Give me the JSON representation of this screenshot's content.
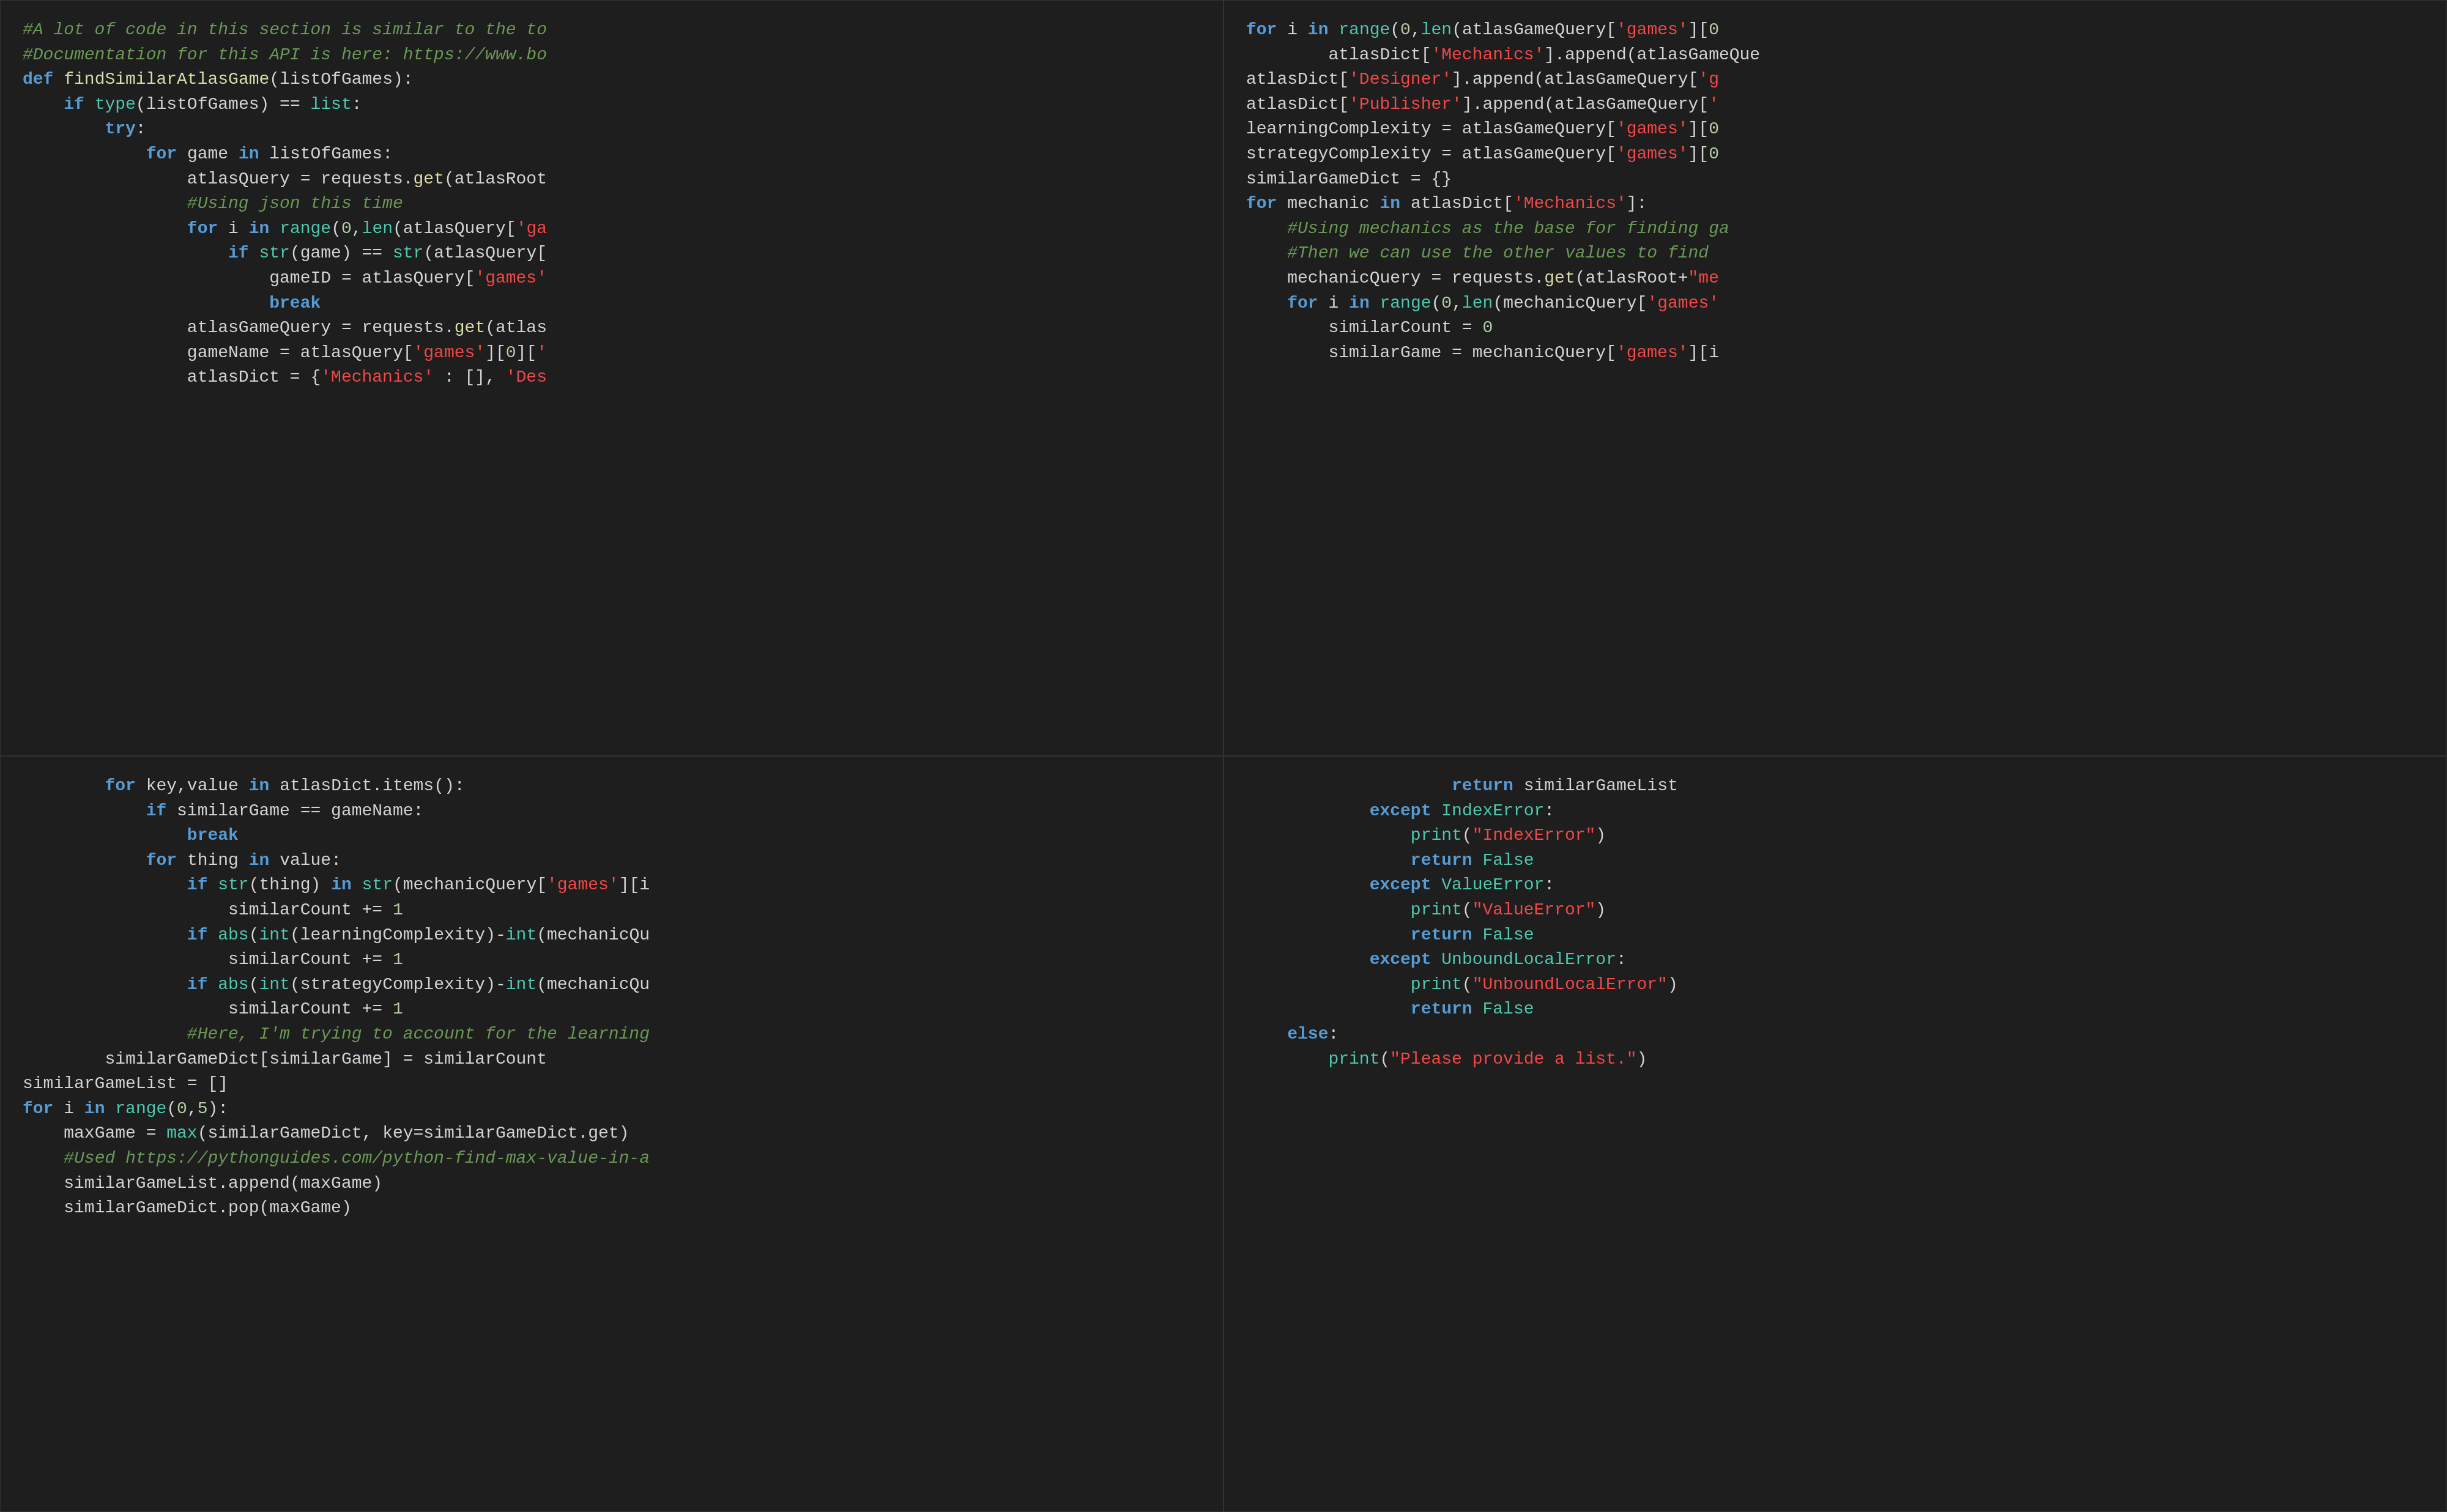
{
  "panels": {
    "top_left": {
      "label": "code-panel-top-left"
    },
    "top_right": {
      "label": "code-panel-top-right"
    },
    "bottom_left": {
      "label": "code-panel-bottom-left"
    },
    "bottom_right": {
      "label": "code-panel-bottom-right"
    }
  }
}
